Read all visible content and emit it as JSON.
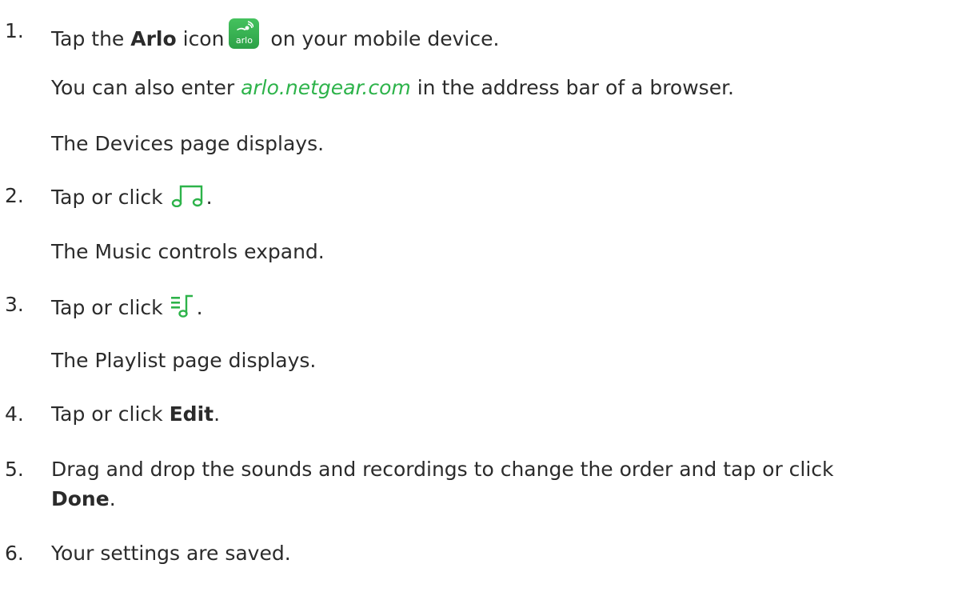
{
  "steps": [
    {
      "number": "1.",
      "before": "Tap the ",
      "bold": "Arlo",
      "after_bold": " icon",
      "after_icon": " on your mobile device.",
      "icon_label": "arlo",
      "sub1_before": "You can also enter ",
      "sub1_link": "arlo.netgear.com",
      "sub1_after": " in the address bar of a browser.",
      "sub2": "The Devices page displays."
    },
    {
      "number": "2.",
      "text": "Tap or click ",
      "after_icon": ".",
      "sub1": "The Music controls expand."
    },
    {
      "number": "3.",
      "text": "Tap or click ",
      "after_icon": ".",
      "sub1": "The Playlist page displays."
    },
    {
      "number": "4.",
      "text": "Tap or click ",
      "bold": "Edit",
      "after_bold": "."
    },
    {
      "number": "5.",
      "text": "Drag and drop the sounds and recordings to change the order and tap or click",
      "bold": "Done",
      "after_bold": "."
    },
    {
      "number": "6.",
      "text": "Your settings are saved."
    }
  ],
  "icons": {
    "arlo": "arlo-app-icon",
    "music": "music-note-icon",
    "playlist": "playlist-icon"
  },
  "colors": {
    "accent": "#2db34a",
    "text": "#2b2b2b"
  }
}
